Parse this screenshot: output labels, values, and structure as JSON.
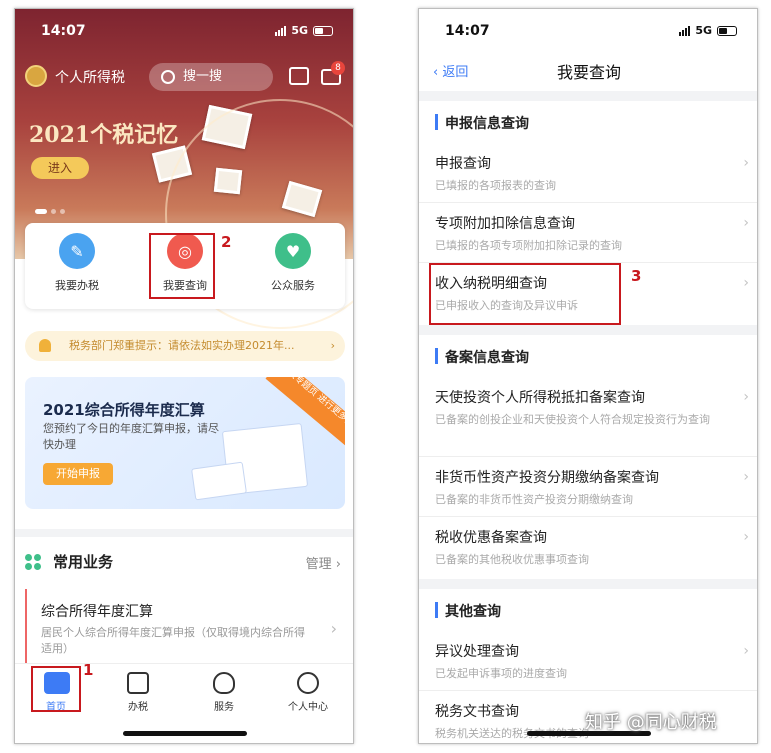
{
  "left_phone": {
    "status": {
      "time": "14:07",
      "network": "5G"
    },
    "header": {
      "app_name": "个人所得税",
      "search_placeholder": "搜一搜",
      "msg_badge": "8"
    },
    "banner": {
      "title": "2021个税记忆",
      "enter_label": "进入"
    },
    "services": [
      {
        "label": "我要办税",
        "color": "#4aa3f0"
      },
      {
        "label": "我要查询",
        "color": "#f05a4f"
      },
      {
        "label": "公众服务",
        "color": "#3fbf8a"
      }
    ],
    "notice": "税务部门郑重提示：请依法如实办理2021年...",
    "promo": {
      "title": "2021综合所得年度汇算",
      "desc": "您预约了今日的年度汇算申报，请尽快办理",
      "button": "开始申报",
      "ribbon": "进入专题页 进行更多操作"
    },
    "common": {
      "title": "常用业务",
      "manage": "管理"
    },
    "card": {
      "title": "综合所得年度汇算",
      "desc": "居民个人综合所得年度汇算申报（仅取得境内综合所得适用）"
    },
    "tabs": [
      "首页",
      "办税",
      "服务",
      "个人中心"
    ],
    "annotations": {
      "n1": "1",
      "n2": "2"
    }
  },
  "right_phone": {
    "status": {
      "time": "14:07",
      "network": "5G"
    },
    "nav": {
      "back": "返回",
      "title": "我要查询"
    },
    "sections": [
      {
        "title": "申报信息查询",
        "rows": [
          {
            "title": "申报查询",
            "desc": "已填报的各项报表的查询"
          },
          {
            "title": "专项附加扣除信息查询",
            "desc": "已填报的各项专项附加扣除记录的查询"
          },
          {
            "title": "收入纳税明细查询",
            "desc": "已申报收入的查询及异议申诉"
          }
        ]
      },
      {
        "title": "备案信息查询",
        "rows": [
          {
            "title": "天使投资个人所得税抵扣备案查询",
            "desc": "已备案的创投企业和天使投资个人符合规定投资行为查询"
          },
          {
            "title": "非货币性资产投资分期缴纳备案查询",
            "desc": "已备案的非货币性资产投资分期缴纳查询"
          },
          {
            "title": "税收优惠备案查询",
            "desc": "已备案的其他税收优惠事项查询"
          }
        ]
      },
      {
        "title": "其他查询",
        "rows": [
          {
            "title": "异议处理查询",
            "desc": "已发起申诉事项的进度查询"
          },
          {
            "title": "税务文书查询",
            "desc": "税务机关送达的税务文书的查询"
          }
        ]
      }
    ],
    "annotations": {
      "n3": "3"
    }
  },
  "watermark": "知乎 @同心财税"
}
